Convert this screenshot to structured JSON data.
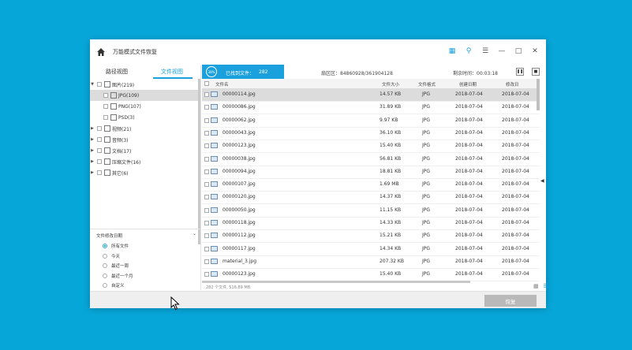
{
  "window": {
    "title": "万能模式文件恢复",
    "icons": [
      "book-icon",
      "key-icon",
      "menu-icon",
      "minimize-icon",
      "maximize-icon",
      "close-icon"
    ]
  },
  "left": {
    "tabs": [
      "路径视图",
      "文件视图"
    ],
    "active_tab": 1,
    "tree": [
      {
        "label": "图片(219)",
        "expanded": true
      },
      {
        "label": "JPG(109)",
        "child": true,
        "selected": true
      },
      {
        "label": "PNG(107)",
        "child": true
      },
      {
        "label": "PSD(3)",
        "child": true
      },
      {
        "label": "视频(21)"
      },
      {
        "label": "音频(3)"
      },
      {
        "label": "文档(17)"
      },
      {
        "label": "压缩文件(16)"
      },
      {
        "label": "其它(6)"
      }
    ],
    "date_filter": {
      "title": "文件修改日期",
      "options": [
        "所有文件",
        "今天",
        "最近一周",
        "最近一个月",
        "自定义"
      ],
      "selected": 0
    }
  },
  "progress": {
    "percent_label": "38%",
    "found_label": "已找到文件：",
    "found_count": "282",
    "sector": "扇区区：84860928/361904128",
    "remaining": "剩余时间：00:03:18"
  },
  "table": {
    "headers": [
      "文件名",
      "文件大小",
      "文件格式",
      "创建日期",
      "修改日"
    ],
    "rows": [
      [
        "00000114.jpg",
        "14.57 KB",
        "JPG",
        "2018-07-04",
        "2018-07-04"
      ],
      [
        "00000086.jpg",
        "31.89 KB",
        "JPG",
        "2018-07-04",
        "2018-07-04"
      ],
      [
        "00000062.jpg",
        "9.97 KB",
        "JPG",
        "2018-07-04",
        "2018-07-04"
      ],
      [
        "00000043.jpg",
        "36.10 KB",
        "JPG",
        "2018-07-04",
        "2018-07-04"
      ],
      [
        "00000123.jpg",
        "15.40 KB",
        "JPG",
        "2018-07-04",
        "2018-07-04"
      ],
      [
        "00000038.jpg",
        "56.81 KB",
        "JPG",
        "2018-07-04",
        "2018-07-04"
      ],
      [
        "00000094.jpg",
        "18.81 KB",
        "JPG",
        "2018-07-04",
        "2018-07-04"
      ],
      [
        "00000107.jpg",
        "1.69 MB",
        "JPG",
        "2018-07-04",
        "2018-07-04"
      ],
      [
        "00000120.jpg",
        "14.37 KB",
        "JPG",
        "2018-07-04",
        "2018-07-04"
      ],
      [
        "00000050.jpg",
        "11.15 KB",
        "JPG",
        "2018-07-04",
        "2018-07-04"
      ],
      [
        "00000118.jpg",
        "14.33 KB",
        "JPG",
        "2018-07-04",
        "2018-07-04"
      ],
      [
        "00000112.jpg",
        "15.21 KB",
        "JPG",
        "2018-07-04",
        "2018-07-04"
      ],
      [
        "00000117.jpg",
        "14.34 KB",
        "JPG",
        "2018-07-04",
        "2018-07-04"
      ],
      [
        "material_3.jpg",
        "207.32 KB",
        "JPG",
        "2018-07-04",
        "2018-07-04"
      ],
      [
        "00000123.jpg",
        "15.40 KB",
        "JPG",
        "2018-07-04",
        "2018-07-04"
      ]
    ],
    "selected_row": 0
  },
  "status": "282 个文件, 516.89 MB",
  "footer": {
    "recover_label": "恢复"
  },
  "colors": {
    "accent": "#1aa0dc",
    "background": "#07a6d9"
  }
}
